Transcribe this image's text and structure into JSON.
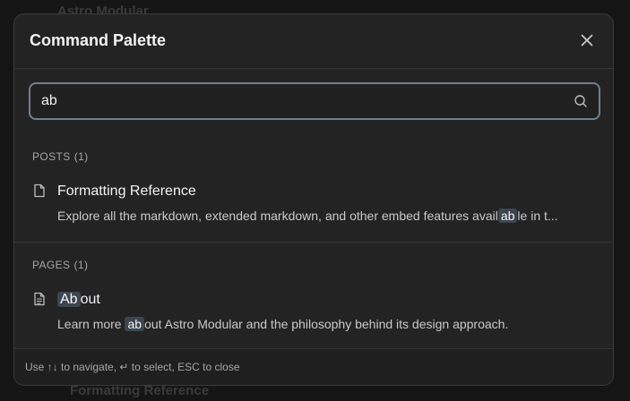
{
  "background": {
    "top_text": "Astro Modular",
    "bottom_text": "Formatting Reference"
  },
  "modal": {
    "title": "Command Palette",
    "close_icon": "close-icon"
  },
  "search": {
    "value": "ab",
    "icon": "search-icon"
  },
  "sections": [
    {
      "label": "POSTS",
      "count": "(1)",
      "results": [
        {
          "icon": "document-icon",
          "title_pre": "",
          "title_hl": "",
          "title_post": "Formatting Reference",
          "desc_pre": "Explore all the markdown, extended markdown, and other embed features avail",
          "desc_hl": "ab",
          "desc_post": "le in t..."
        }
      ]
    },
    {
      "label": "PAGES",
      "count": "(1)",
      "results": [
        {
          "icon": "page-lines-icon",
          "title_pre": "",
          "title_hl": "Ab",
          "title_post": "out",
          "desc_pre": "Learn more ",
          "desc_hl": "ab",
          "desc_post": "out Astro Modular and the philosophy behind its design approach."
        }
      ]
    }
  ],
  "footer": {
    "hint": "Use ↑↓ to navigate, ↵ to select, ESC to close"
  },
  "colors": {
    "modal_bg": "#232323",
    "highlight_bg": "#3c4650",
    "focus_border": "#6f7f8e"
  }
}
